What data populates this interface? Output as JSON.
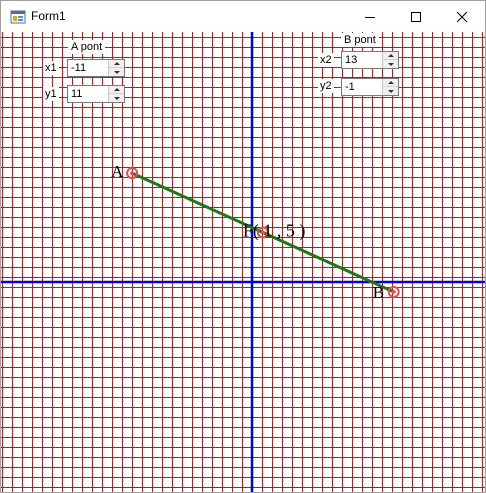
{
  "window": {
    "title": "Form1",
    "icon": "app-form-icon"
  },
  "titlebar": {
    "minimize_icon": "minimize-icon",
    "maximize_icon": "maximize-icon",
    "close_icon": "close-icon"
  },
  "point_a": {
    "group_label": "A pont",
    "x_label": "x1",
    "x_value": "-11",
    "y_label": "y1",
    "y_value": "11"
  },
  "point_b": {
    "group_label": "B pont",
    "x_label": "x2",
    "x_value": "13",
    "y_label": "y2",
    "y_value": "-1"
  },
  "plot": {
    "unit_step": 1,
    "point_a": {
      "label": "A",
      "x": -11,
      "y": 11
    },
    "point_b": {
      "label": "B",
      "x": 13,
      "y": -1
    },
    "midpoint": {
      "label": "F( 1 , 5 )",
      "x": 1,
      "y": 5
    },
    "colors": {
      "grid": "#b01e1e",
      "axes": "#0000e0",
      "segment": "#1a7a1a",
      "marker": "#e05050"
    }
  }
}
